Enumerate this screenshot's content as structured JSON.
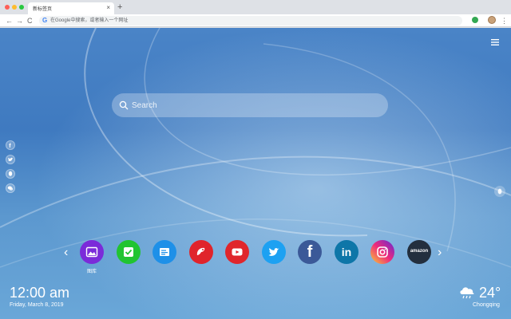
{
  "browser": {
    "tab_title": "新标签页",
    "tab_close": "×",
    "new_tab": "+",
    "back": "←",
    "forward": "→",
    "reload": "C",
    "omnibox_placeholder": "在Google中搜索，或者输入一个网址",
    "omnibox_logo": "G",
    "menu": "⋮"
  },
  "search": {
    "placeholder": "Search"
  },
  "social_links": [
    "facebook-icon",
    "twitter-icon",
    "qq-icon",
    "wechat-icon"
  ],
  "apps": [
    {
      "name": "gallery",
      "label": "图库",
      "color": "#7b2bd9"
    },
    {
      "name": "tasks",
      "label": "",
      "color": "#21c431"
    },
    {
      "name": "notes",
      "label": "",
      "color": "#1e90e8"
    },
    {
      "name": "games",
      "label": "",
      "color": "#e0242b"
    },
    {
      "name": "youtube",
      "label": "",
      "color": "#e0262c"
    },
    {
      "name": "twitter",
      "label": "",
      "color": "#1da1f2"
    },
    {
      "name": "facebook",
      "label": "f",
      "color": "#3b5998"
    },
    {
      "name": "linkedin",
      "label": "in",
      "color": "#0e76a8"
    },
    {
      "name": "instagram",
      "label": "",
      "color": "#d6249f"
    },
    {
      "name": "amazon",
      "label": "amazon",
      "color": "#232f3e"
    }
  ],
  "nav": {
    "prev": "‹",
    "next": "›"
  },
  "clock": {
    "time": "12:00 am",
    "date": "Friday, March 8, 2019"
  },
  "weather": {
    "temperature": "24°",
    "city": "Chongqing",
    "icon": "cloud-rain-icon"
  }
}
